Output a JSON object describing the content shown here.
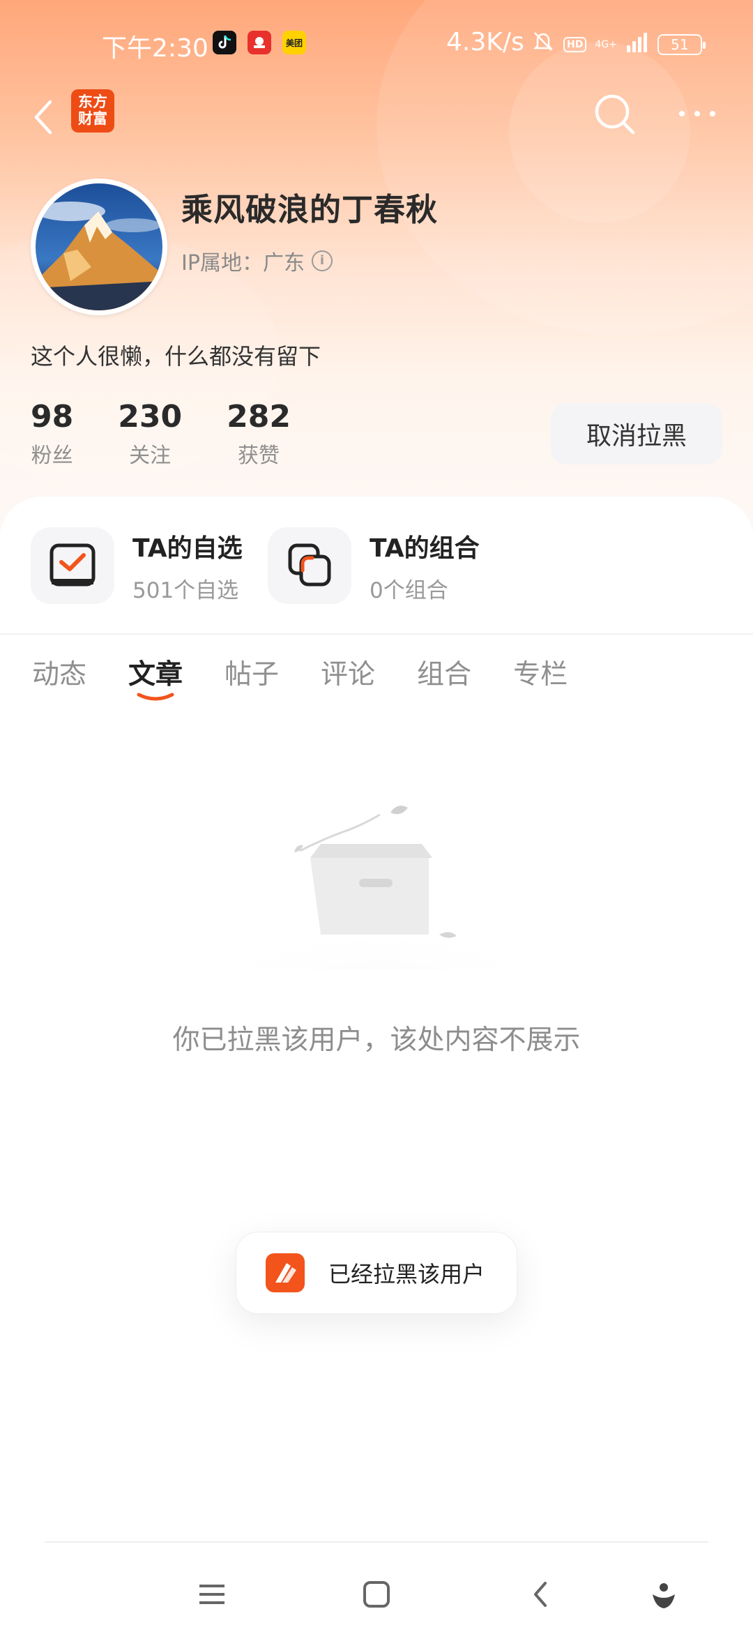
{
  "status_bar": {
    "time": "下午2:30",
    "app_icons": [
      "tiktok-icon",
      "app-notification-icon",
      "meituan-icon"
    ],
    "meituan_label": "美团",
    "network_speed": "4.3K/s",
    "hd_badge": "HD",
    "network_type": "4G+",
    "battery": "51"
  },
  "nav": {
    "logo_text_line1": "东方",
    "logo_text_line2": "财富"
  },
  "profile": {
    "username": "乘风破浪的丁春秋",
    "ip_location": "IP属地：广东",
    "bio": "这个人很懒，什么都没有留下",
    "stats": [
      {
        "value": "98",
        "label": "粉丝"
      },
      {
        "value": "230",
        "label": "关注"
      },
      {
        "value": "282",
        "label": "获赞"
      }
    ],
    "unblock_label": "取消拉黑"
  },
  "quick_links": [
    {
      "title": "TA的自选",
      "subtitle": "501个自选",
      "icon": "watchlist-check-icon"
    },
    {
      "title": "TA的组合",
      "subtitle": "0个组合",
      "icon": "portfolio-icon"
    }
  ],
  "tabs": [
    {
      "label": "动态",
      "active": false
    },
    {
      "label": "文章",
      "active": true
    },
    {
      "label": "帖子",
      "active": false
    },
    {
      "label": "评论",
      "active": false
    },
    {
      "label": "组合",
      "active": false
    },
    {
      "label": "专栏",
      "active": false
    }
  ],
  "empty_state": {
    "message": "你已拉黑该用户，该处内容不展示",
    "illustration": "empty-box-illustration"
  },
  "toast": {
    "message": "已经拉黑该用户",
    "icon": "eastmoney-logo-icon"
  },
  "system_nav": [
    "menu-icon",
    "home-icon",
    "back-icon",
    "assistant-icon"
  ],
  "colors": {
    "accent": "#f2541c",
    "header_gradient_top": "#ffa77a",
    "text_primary": "#222222",
    "text_secondary": "#8f8f8f"
  }
}
